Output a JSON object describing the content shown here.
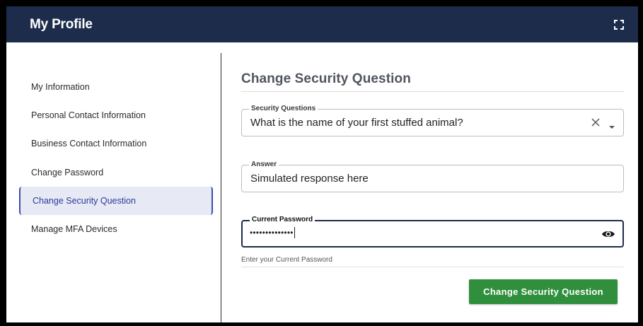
{
  "header": {
    "title": "My Profile",
    "expand_icon": "fullscreen-icon"
  },
  "sidebar": {
    "items": [
      {
        "label": "My Information",
        "active": false
      },
      {
        "label": "Personal Contact Information",
        "active": false
      },
      {
        "label": "Business Contact Information",
        "active": false
      },
      {
        "label": "Change Password",
        "active": false
      },
      {
        "label": "Change Security Question",
        "active": true
      },
      {
        "label": "Manage MFA Devices",
        "active": false
      }
    ]
  },
  "form": {
    "title": "Change Security Question",
    "security_question": {
      "label": "Security Questions",
      "value": "What is the name of your first stuffed animal?"
    },
    "answer": {
      "label": "Answer",
      "value": "Simulated response here"
    },
    "current_password": {
      "label": "Current Password",
      "masked_value": "••••••••••••••",
      "helper": "Enter your Current Password"
    },
    "submit_label": "Change Security Question"
  },
  "colors": {
    "header_bg": "#1d2c4b",
    "active_nav_bg": "#e7e9f4",
    "active_nav_accent": "#3a4cb8",
    "submit_bg": "#2f8f3c"
  }
}
